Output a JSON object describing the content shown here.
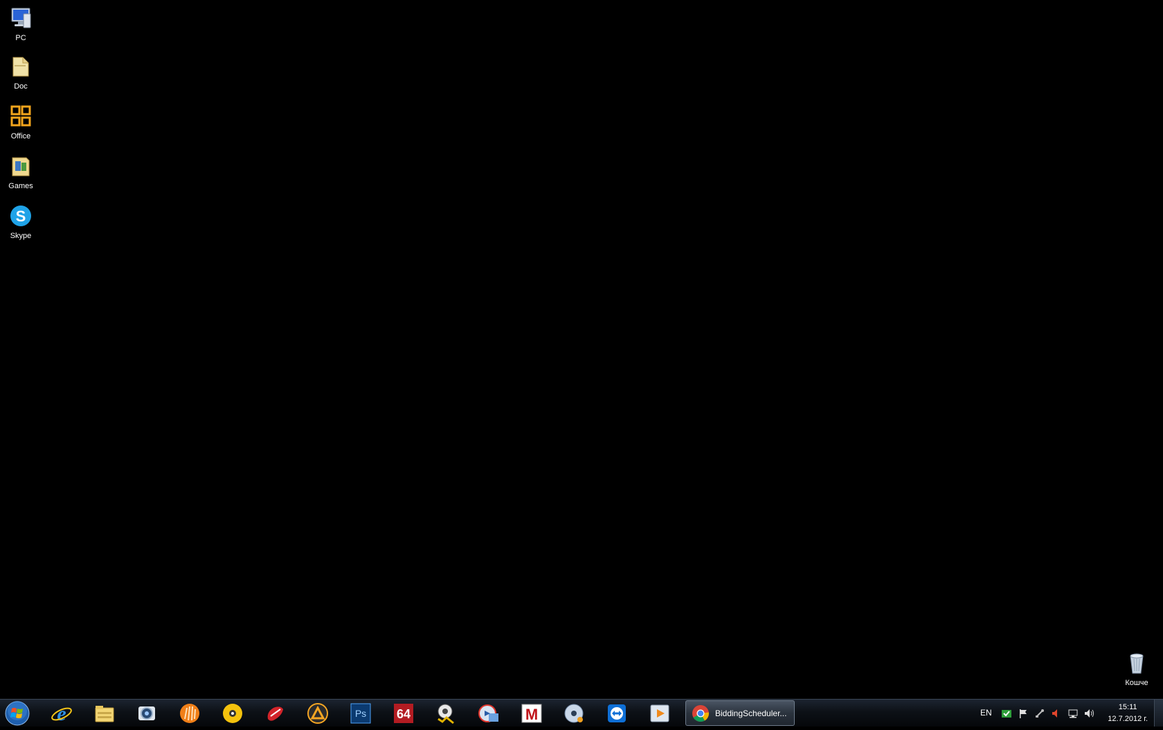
{
  "desktop": {
    "icons": [
      {
        "label": "PC",
        "icon": "computer-icon"
      },
      {
        "label": "Doc",
        "icon": "folder-icon"
      },
      {
        "label": "Office",
        "icon": "office-icon"
      },
      {
        "label": "Games",
        "icon": "games-folder-icon"
      },
      {
        "label": "Skype",
        "icon": "skype-icon"
      }
    ],
    "recycle_bin": {
      "label": "Кошче",
      "icon": "recycle-bin-icon"
    }
  },
  "taskbar": {
    "start_icon": "windows-start-orb",
    "pinned": [
      "internet-explorer-icon",
      "explorer-folder-icon",
      "camera-app-icon",
      "orange-media-icon",
      "cd-burner-icon",
      "game-mouse-icon",
      "aimp-player-icon",
      "photoshop-icon",
      "aida64-icon",
      "gold-badge-icon",
      "media-converter-icon",
      "malwarebytes-icon",
      "dvd-tool-icon",
      "teamviewer-icon",
      "video-player-icon"
    ],
    "photoshop_text": "Ps",
    "aida_text": "64",
    "malware_text": "M",
    "active_window": {
      "title": "BiddingScheduler...",
      "icon": "chrome-icon"
    },
    "tray": {
      "language": "EN",
      "icons": [
        "shield-check-icon",
        "action-center-flag-icon",
        "network-tool-icon",
        "speaker-muted-icon",
        "network-icon",
        "volume-icon"
      ],
      "time": "15:11",
      "date": "12.7.2012 г."
    }
  },
  "colors": {
    "background": "#000000",
    "taskbar": "#0d1117"
  }
}
